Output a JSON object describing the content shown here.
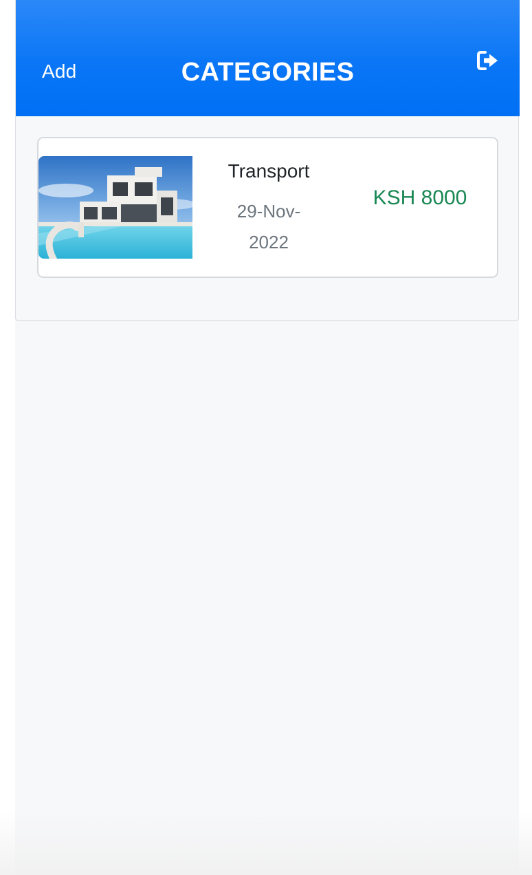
{
  "header": {
    "add_label": "Add",
    "title": "CATEGORIES",
    "logout_icon": "sign-out-icon",
    "background_color": "#0a76f6"
  },
  "categories": [
    {
      "name": "Transport",
      "date": "29-Nov-2022",
      "amount": "KSH 8000",
      "amount_color": "#198754",
      "image_icon": "house-with-pool-photo"
    }
  ]
}
